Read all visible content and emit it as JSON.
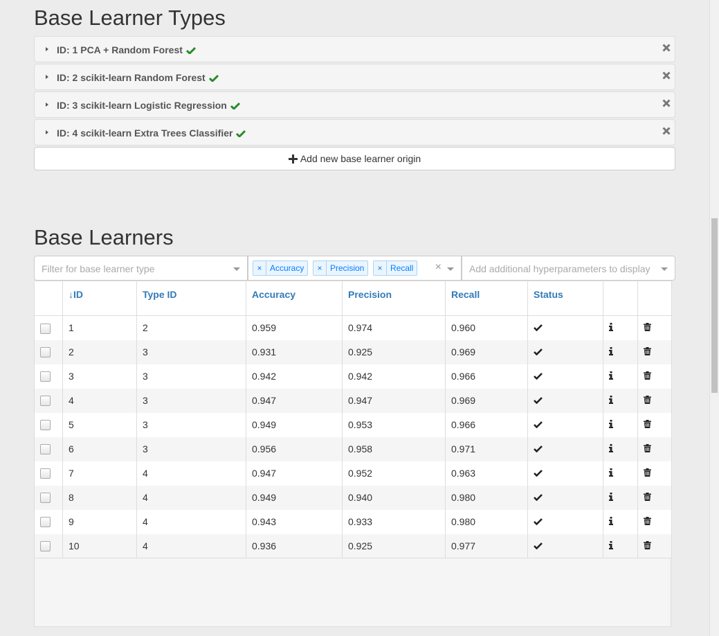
{
  "types_section": {
    "title": "Base Learner Types",
    "items": [
      {
        "label": "ID: 1 PCA + Random Forest"
      },
      {
        "label": "ID: 2 scikit-learn Random Forest"
      },
      {
        "label": "ID: 3 scikit-learn Logistic Regression"
      },
      {
        "label": "ID: 4 scikit-learn Extra Trees Classifier"
      }
    ],
    "add_button_label": "Add new base learner origin"
  },
  "learners_section": {
    "title": "Base Learners",
    "filter_type_placeholder": "Filter for base learner type",
    "metric_tags": [
      "Accuracy",
      "Precision",
      "Recall"
    ],
    "hyperparams_placeholder": "Add additional hyperparameters to display",
    "columns": [
      "↓ID",
      "Type ID",
      "Accuracy",
      "Precision",
      "Recall",
      "Status"
    ],
    "rows": [
      {
        "id": "1",
        "type_id": "2",
        "accuracy": "0.959",
        "precision": "0.974",
        "recall": "0.960"
      },
      {
        "id": "2",
        "type_id": "3",
        "accuracy": "0.931",
        "precision": "0.925",
        "recall": "0.969"
      },
      {
        "id": "3",
        "type_id": "3",
        "accuracy": "0.942",
        "precision": "0.942",
        "recall": "0.966"
      },
      {
        "id": "4",
        "type_id": "3",
        "accuracy": "0.947",
        "precision": "0.947",
        "recall": "0.969"
      },
      {
        "id": "5",
        "type_id": "3",
        "accuracy": "0.949",
        "precision": "0.953",
        "recall": "0.966"
      },
      {
        "id": "6",
        "type_id": "3",
        "accuracy": "0.956",
        "precision": "0.958",
        "recall": "0.971"
      },
      {
        "id": "7",
        "type_id": "4",
        "accuracy": "0.947",
        "precision": "0.952",
        "recall": "0.963"
      },
      {
        "id": "8",
        "type_id": "4",
        "accuracy": "0.949",
        "precision": "0.940",
        "recall": "0.980"
      },
      {
        "id": "9",
        "type_id": "4",
        "accuracy": "0.943",
        "precision": "0.933",
        "recall": "0.980"
      },
      {
        "id": "10",
        "type_id": "4",
        "accuracy": "0.936",
        "precision": "0.925",
        "recall": "0.977"
      }
    ]
  },
  "colors": {
    "check_green": "#2a8a2a",
    "link_blue": "#337ab7",
    "tag_blue": "#007eff"
  },
  "icons": [
    "caret-right-icon",
    "checkmark-icon",
    "close-icon",
    "plus-icon",
    "info-icon",
    "trash-icon",
    "chevron-down-icon"
  ]
}
